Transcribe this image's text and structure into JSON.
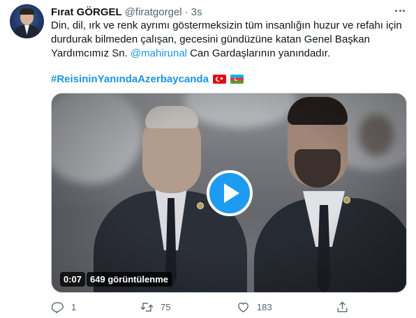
{
  "author": {
    "name": "Fırat GÖRGEL",
    "handle": "@firatgorgel",
    "separator": "·",
    "time": "3s"
  },
  "tweet": {
    "text_before": "Din, dil, ırk ve renk ayrımı göstermeksizin tüm insanlığın huzur ve refahı için durdurak bilmeden çalışan, gecesini gündüzüne katan Genel Başkan Yardımcımız Sn. ",
    "mention": "@mahirunal",
    "text_after": " Can Gardaşlarının yanındadır.",
    "hashtag": "#ReisininYanındaAzerbaycanda",
    "flags": [
      "turkey-flag-icon",
      "azerbaijan-flag-icon"
    ]
  },
  "media": {
    "type": "video",
    "duration": "0:07",
    "views": "649 görüntülenme",
    "play_icon": "play-icon"
  },
  "actions": {
    "reply": {
      "icon": "reply-icon",
      "count": "1"
    },
    "retweet": {
      "icon": "retweet-icon",
      "count": "75"
    },
    "like": {
      "icon": "heart-icon",
      "count": "183"
    },
    "share": {
      "icon": "share-icon"
    }
  },
  "colors": {
    "accent": "#1b95e0",
    "play_button": "#1d9bf0",
    "text_primary": "#0f1419",
    "text_secondary": "#536471"
  }
}
